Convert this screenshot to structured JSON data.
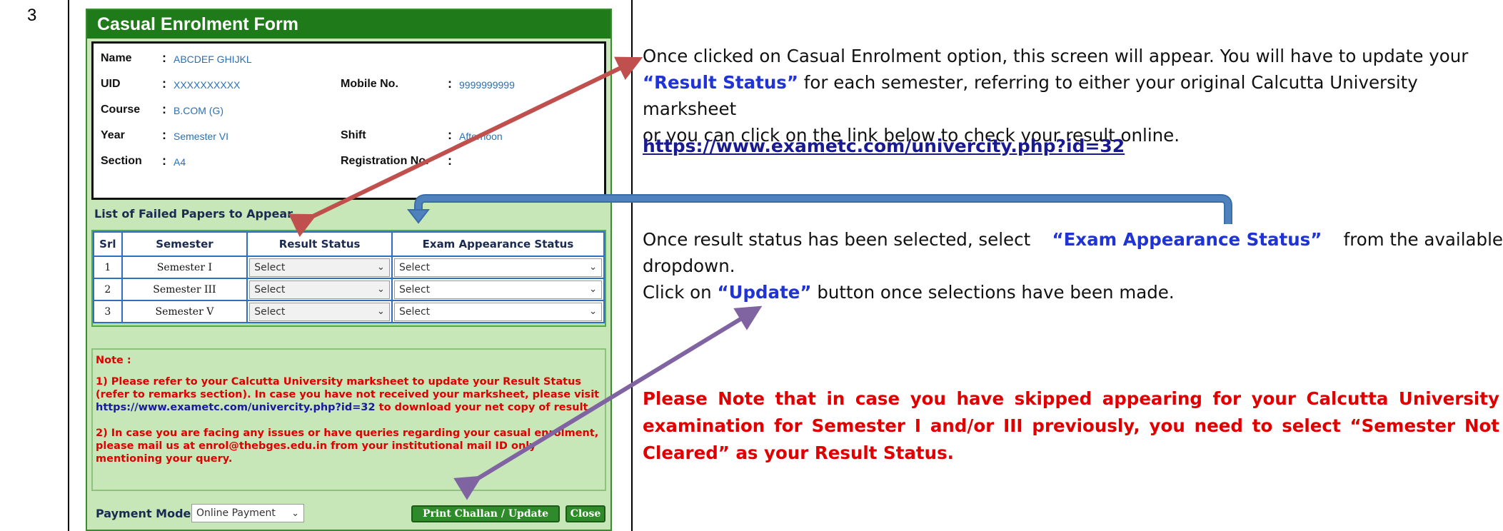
{
  "row_number": "3",
  "form": {
    "title": "Casual Enrolment Form",
    "info": {
      "name_label": "Name",
      "name_value": "ABCDEF GHIJKL",
      "uid_label": "UID",
      "uid_value": "XXXXXXXXXX",
      "mobile_label": "Mobile No.",
      "mobile_value": "9999999999",
      "course_label": "Course",
      "course_value": "B.COM (G)",
      "year_label": "Year",
      "year_value": "Semester VI",
      "shift_label": "Shift",
      "shift_value": "Afternoon",
      "section_label": "Section",
      "section_value": "A4",
      "reg_label": "Registration No.",
      "reg_value": ""
    },
    "papers_title": "List of Failed Papers to Appear",
    "table": {
      "headers": [
        "Srl",
        "Semester",
        "Result Status",
        "Exam Appearance Status"
      ],
      "rows": [
        {
          "srl": "1",
          "semester": "Semester I",
          "result": "Select",
          "exam": "Select"
        },
        {
          "srl": "2",
          "semester": "Semester III",
          "result": "Select",
          "exam": "Select"
        },
        {
          "srl": "3",
          "semester": "Semester V",
          "result": "Select",
          "exam": "Select"
        }
      ]
    },
    "note": {
      "heading": "Note :",
      "p1_a": "1) Please refer to your Calcutta University marksheet to update your Result Status (refer to remarks section). In case you have not received your marksheet, please visit ",
      "p1_link": "https://www.exametc.com/univercity.php?id=32",
      "p1_b": " to download your net copy of result.",
      "p2": "2) In case you are facing any issues or have queries regarding your casual enrolment, please mail us at enrol@thebges.edu.in from your institutional mail ID only mentioning your query."
    },
    "payment_label": "Payment Mode",
    "payment_value": "Online Payment",
    "print_button": "Print Challan / Update",
    "close_button": "Close"
  },
  "instructions": {
    "para1_a": "Once clicked on Casual Enrolment option, this screen will appear. You will have to update your",
    "para1_b_bold": "“Result Status”",
    "para1_b_rest": " for each semester, referring to either your original Calcutta University marksheet",
    "para1_c": "or you can click on the link below to check your result online.",
    "link": "https://www.exametc.com/univercity.php?id=32",
    "para2_a": "Once result status has been selected, select ",
    "para2_bold": "“Exam Appearance Status”",
    "para2_b": " from the available",
    "para2_c": "dropdown.",
    "para3_a": "Click on ",
    "para3_bold": "“Update”",
    "para3_b": " button once selections have been made.",
    "red_note": "Please Note that in case you have skipped appearing for your Calcutta University examination for Semester I and/or III previously, you need to select “Semester Not Cleared” as your Result Status."
  },
  "colors": {
    "header_green": "#1f7a1a",
    "panel_green": "#c7e7b9",
    "arrow_red": "#c0504d",
    "arrow_blue": "#4f81bd",
    "arrow_purple": "#8064a2",
    "note_red": "#e00000",
    "highlight_blue": "#1f33d6"
  }
}
